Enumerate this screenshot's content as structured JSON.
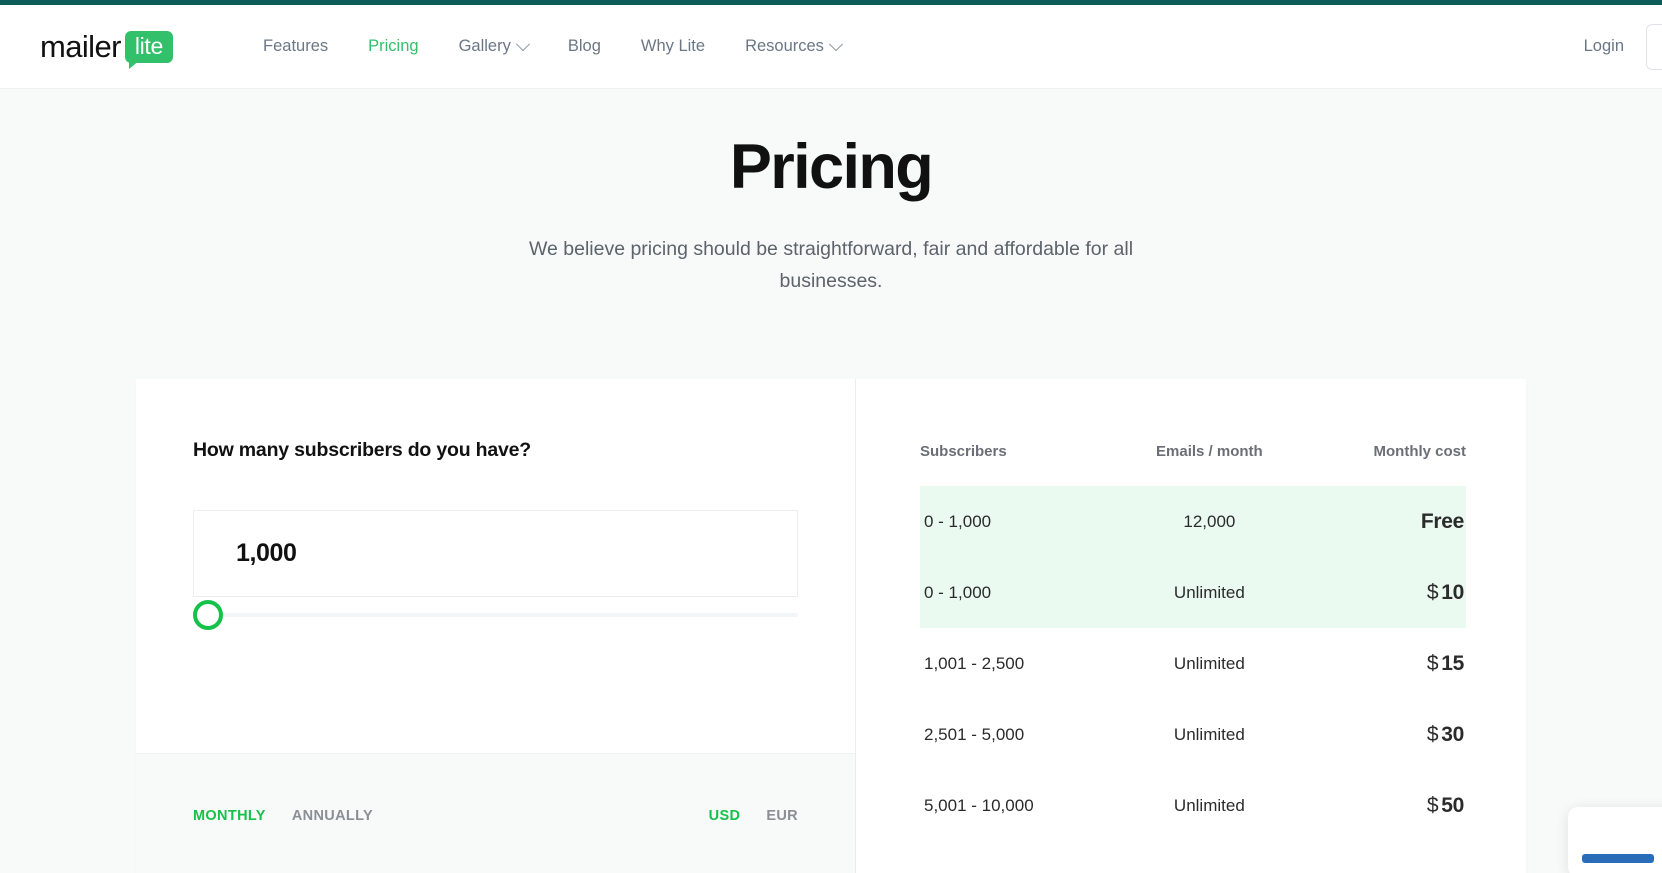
{
  "brand": {
    "logo_word": "mailer",
    "logo_badge": "lite",
    "accent_green": "#32c16a",
    "slider_green": "#14c24a",
    "top_strip_color": "#0b5b5b",
    "highlight_row_bg": "#eafaf0"
  },
  "header": {
    "nav": [
      {
        "label": "Features",
        "active": false,
        "has_chevron": false
      },
      {
        "label": "Pricing",
        "active": true,
        "has_chevron": false
      },
      {
        "label": "Gallery",
        "active": false,
        "has_chevron": true
      },
      {
        "label": "Blog",
        "active": false,
        "has_chevron": false
      },
      {
        "label": "Why Lite",
        "active": false,
        "has_chevron": false
      },
      {
        "label": "Resources",
        "active": false,
        "has_chevron": true
      }
    ],
    "login_label": "Login",
    "signup_label": ""
  },
  "hero": {
    "title": "Pricing",
    "subtitle": "We believe pricing should be straightforward, fair and affordable for all businesses."
  },
  "calculator": {
    "question": "How many subscribers do you have?",
    "slider": {
      "value_label": "1,000",
      "value": 1000,
      "min": 0,
      "max": 600000,
      "handle_position_percent": 0
    },
    "billing_toggle": {
      "options": [
        {
          "label": "MONTHLY",
          "active": true
        },
        {
          "label": "ANNUALLY",
          "active": false
        }
      ]
    },
    "currency_toggle": {
      "options": [
        {
          "label": "USD",
          "active": true
        },
        {
          "label": "EUR",
          "active": false
        }
      ]
    }
  },
  "pricing_table": {
    "headers": {
      "subscribers": "Subscribers",
      "emails": "Emails / month",
      "cost": "Monthly cost"
    },
    "rows": [
      {
        "subscribers": "0 - 1,000",
        "emails": "12,000",
        "currency": "",
        "cost": "Free",
        "highlight": true
      },
      {
        "subscribers": "0 - 1,000",
        "emails": "Unlimited",
        "currency": "$",
        "cost": "10",
        "highlight": true
      },
      {
        "subscribers": "1,001 - 2,500",
        "emails": "Unlimited",
        "currency": "$",
        "cost": "15",
        "highlight": false
      },
      {
        "subscribers": "2,501 - 5,000",
        "emails": "Unlimited",
        "currency": "$",
        "cost": "30",
        "highlight": false
      },
      {
        "subscribers": "5,001 - 10,000",
        "emails": "Unlimited",
        "currency": "$",
        "cost": "50",
        "highlight": false
      }
    ]
  }
}
